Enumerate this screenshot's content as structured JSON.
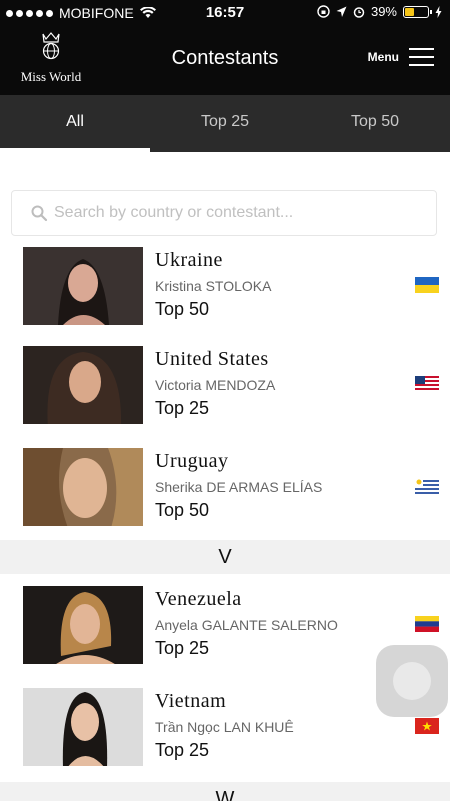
{
  "status": {
    "carrier": "MOBIFONE",
    "time": "16:57",
    "battery": "39%"
  },
  "header": {
    "brand": "Miss World",
    "title": "Contestants",
    "menu_label": "Menu"
  },
  "tabs": [
    {
      "label": "All",
      "active": true
    },
    {
      "label": "Top 25",
      "active": false
    },
    {
      "label": "Top 50",
      "active": false
    }
  ],
  "search": {
    "placeholder": "Search by country or contestant..."
  },
  "sections": {
    "v": "V",
    "w": "W"
  },
  "contestants": [
    {
      "country": "Ukraine",
      "name": "Kristina STOLOKA",
      "rank": "Top 50",
      "flag": "ukraine-flag-icon"
    },
    {
      "country": "United States",
      "name": "Victoria MENDOZA",
      "rank": "Top 25",
      "flag": "usa-flag-icon"
    },
    {
      "country": "Uruguay",
      "name": "Sherika DE ARMAS ELÍAS",
      "rank": "Top 50",
      "flag": "uruguay-flag-icon"
    },
    {
      "country": "Venezuela",
      "name": "Anyela GALANTE SALERNO",
      "rank": "Top 25",
      "flag": "venezuela-flag-icon"
    },
    {
      "country": "Vietnam",
      "name": "Trần Ngọc LAN KHUÊ",
      "rank": "Top 25",
      "flag": "vietnam-flag-icon"
    }
  ],
  "colors": {
    "header_bg": "#0a0a0a",
    "tabs_bg": "#2b2b2b",
    "section_bg": "#f1f1f1"
  }
}
